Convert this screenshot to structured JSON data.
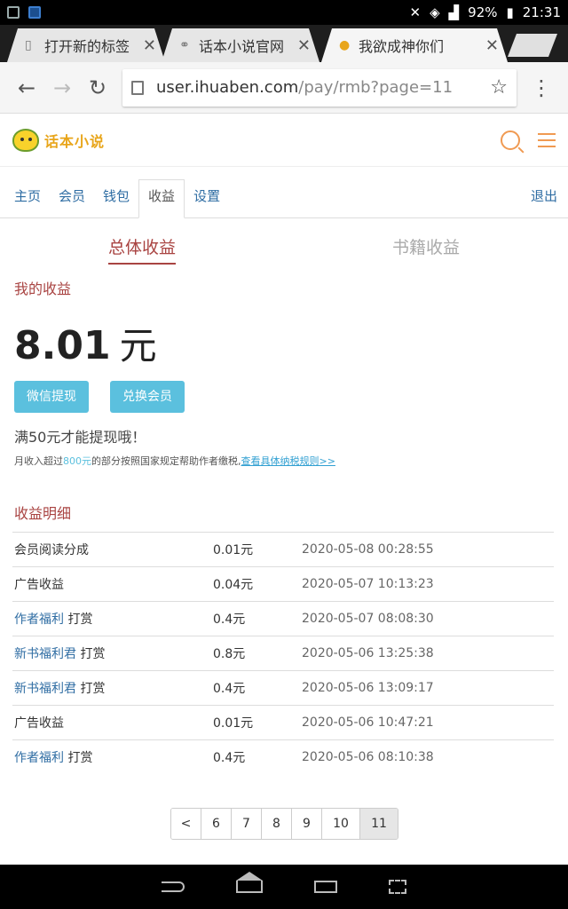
{
  "status": {
    "battery": "92%",
    "time": "21:31"
  },
  "tabs": [
    {
      "title": "打开新的标签",
      "icon": "document-icon"
    },
    {
      "title": "话本小说官网",
      "icon": "link-icon"
    },
    {
      "title": "我欲成神你们",
      "icon": "site-favicon"
    }
  ],
  "toolbar": {
    "url_host": "user.ihuaben.com",
    "url_path": "/pay/rmb?page=11"
  },
  "site": {
    "logo_text": "话本小说"
  },
  "nav": {
    "items": [
      "主页",
      "会员",
      "钱包",
      "收益",
      "设置"
    ],
    "logout": "退出"
  },
  "income_tabs": [
    "总体收益",
    "书籍收益"
  ],
  "earnings": {
    "title": "我的收益",
    "amount": "8.01",
    "unit": "元",
    "wechat_btn": "微信提现",
    "exchange_btn": "兑换会员",
    "min_note": "满50元才能提现哦！",
    "tax_note_prefix": "月收入超过",
    "tax_note_amount": "800元",
    "tax_note_suffix": "的部分按照国家规定帮助作者缴税,",
    "tax_link": "查看具体纳税规则>>"
  },
  "details": {
    "title": "收益明细",
    "rows": [
      {
        "source_link": "",
        "source": "会员阅读分成",
        "amount": "0.01元",
        "time": "2020-05-08 00:28:55"
      },
      {
        "source_link": "",
        "source": "广告收益",
        "amount": "0.04元",
        "time": "2020-05-07 10:13:23"
      },
      {
        "source_link": "作者福利",
        "source": "打赏",
        "amount": "0.4元",
        "time": "2020-05-07 08:08:30"
      },
      {
        "source_link": "新书福利君",
        "source": "打赏",
        "amount": "0.8元",
        "time": "2020-05-06 13:25:38"
      },
      {
        "source_link": "新书福利君",
        "source": "打赏",
        "amount": "0.4元",
        "time": "2020-05-06 13:09:17"
      },
      {
        "source_link": "",
        "source": "广告收益",
        "amount": "0.01元",
        "time": "2020-05-06 10:47:21"
      },
      {
        "source_link": "作者福利",
        "source": "打赏",
        "amount": "0.4元",
        "time": "2020-05-06 08:10:38"
      }
    ]
  },
  "pagination": {
    "prev": "<",
    "pages": [
      "6",
      "7",
      "8",
      "9",
      "10",
      "11"
    ],
    "current": "11"
  }
}
